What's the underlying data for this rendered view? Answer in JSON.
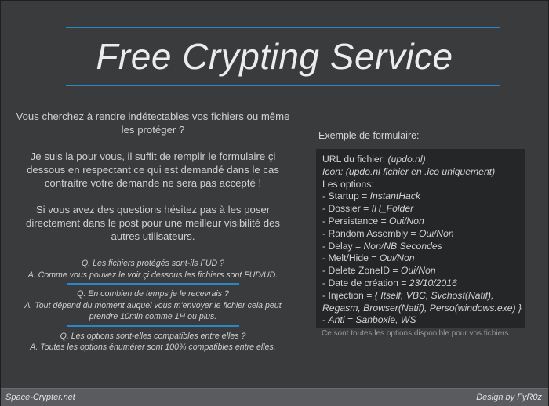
{
  "title": "Free Crypting Service",
  "intro": [
    "Vous cherchez à rendre indétectables vos fichiers ou même les protéger ?",
    "Je suis la pour vous, il suffit de remplir le formulaire çi dessous en respectant ce qui est demandé dans le cas contraitre votre demande ne sera pas accepté !",
    "Si vous avez des questions hésitez pas à les poser directement dans le post pour une meilleur visibilité des autres utilisateurs."
  ],
  "faq": [
    {
      "q": "Q. Les fichiers protégés sont-ils FUD ?",
      "a": "A. Comme vous pouvez le voir çi dessous les fichiers sont FUD/UD."
    },
    {
      "q": "Q. En combien de temps je le recevrais ?",
      "a": "A. Tout dépend du moment auquel vous m'envoyer le fichier cela peut prendre 10min comme 1H ou plus."
    },
    {
      "q": "Q. Les options sont-elles compatibles entre elles ?",
      "a": "A. Toutes les options énumérer sont 100% compatibles entre elles."
    }
  ],
  "example": {
    "heading": "Exemple de formulaire:",
    "lines": [
      {
        "label": "URL du fichier: ",
        "value": "(updo.nl)",
        "italic_label": false
      },
      {
        "label": "Icon: (updo.nl fichier en .ico uniquement)",
        "value": "",
        "italic_label": true
      },
      {
        "label": "Les options:",
        "value": "",
        "italic_label": false
      },
      {
        "label": "- Startup = ",
        "value": "InstantHack",
        "italic_label": false
      },
      {
        "label": "- Dossier = ",
        "value": "IH_Folder",
        "italic_label": false
      },
      {
        "label": "- Persistance = ",
        "value": "Oui/Non",
        "italic_label": false
      },
      {
        "label": "- Random Assembly = ",
        "value": "Oui/Non",
        "italic_label": false
      },
      {
        "label": "- Delay = ",
        "value": "Non/NB Secondes",
        "italic_label": false
      },
      {
        "label": "- Melt/Hide = ",
        "value": "Oui/Non",
        "italic_label": false
      },
      {
        "label": "- Delete ZoneID = ",
        "value": "Oui/Non",
        "italic_label": false
      },
      {
        "label": "- Date de création = ",
        "value": "23/10/2016",
        "italic_label": false
      },
      {
        "label": "- Injection = ",
        "value": "{ Itself, VBC, Svchost(Natif),",
        "italic_label": false
      },
      {
        "label": "",
        "value": "Regasm, Browser(Natif), Perso(windows.exe) }",
        "italic_label": false
      },
      {
        "label": "- ",
        "value": "Anti = Sanboxie, WS",
        "italic_label": false
      }
    ],
    "footnote": "Ce sont toutes les options disponible pour vos fichiers."
  },
  "footer": {
    "left": "Space-Crypter.net",
    "right": "Design by FyR0z"
  },
  "colors": {
    "background": "#3a3b3d",
    "accent": "#2b86c8",
    "box": "#252628",
    "footer": "#5a5b5e"
  }
}
